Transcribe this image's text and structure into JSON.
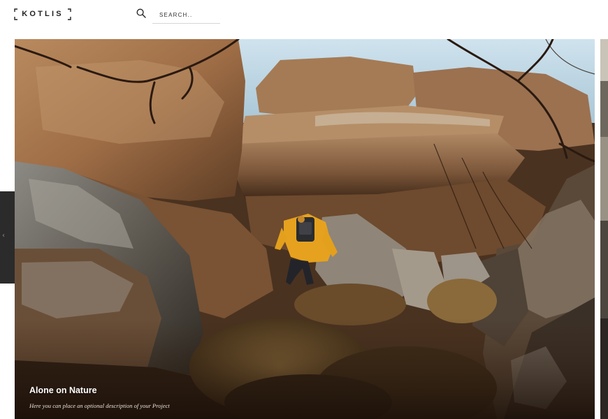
{
  "header": {
    "logo_text": "KOTLIS",
    "search": {
      "placeholder": "SEARCH..",
      "value": "",
      "icon": "search-icon"
    }
  },
  "slider": {
    "current_slide": {
      "title": "Alone on Nature",
      "description": "Here you can place an optional description of your Project"
    },
    "prev_arrow": {
      "icon": "chevron-left-icon",
      "glyph": "‹"
    },
    "next_slide_peek": {
      "icon": "next-slide-thumbnail"
    }
  },
  "colors": {
    "text": "#222222",
    "caption_title": "#ffffff",
    "caption_desc": "#e6e0d8",
    "arrow_tab": "#2b2b2b",
    "divider": "#d6d6d6"
  }
}
